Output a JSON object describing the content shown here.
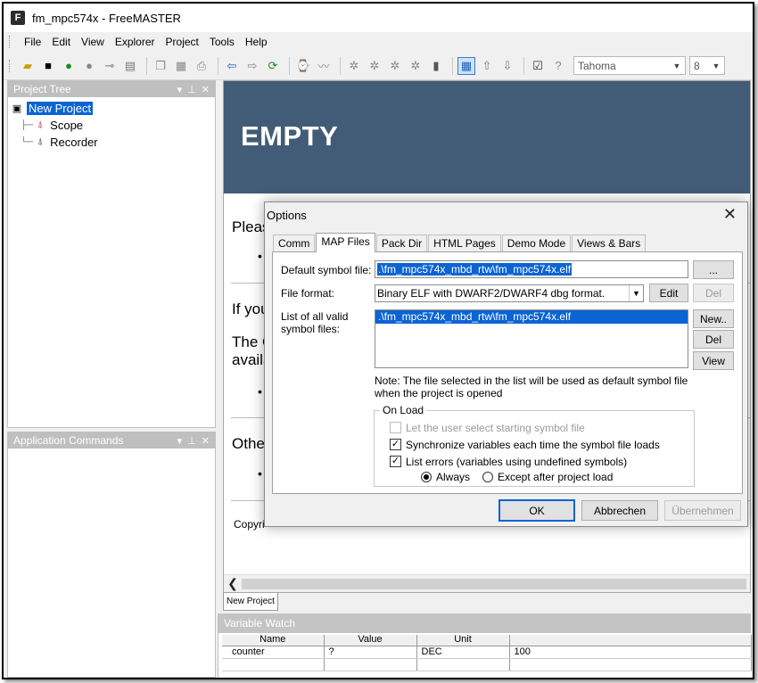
{
  "window": {
    "title": "fm_mpc574x - FreeMASTER",
    "app_icon": "F"
  },
  "menu": [
    "File",
    "Edit",
    "View",
    "Explorer",
    "Project",
    "Tools",
    "Help"
  ],
  "toolbar": {
    "font_name": "Tahoma",
    "font_size": "8",
    "icons": [
      "open-folder-icon",
      "save-icon",
      "go-icon",
      "stop-icon",
      "key-icon",
      "properties-icon",
      "copy-icon",
      "paste-icon",
      "print-icon",
      "back-arrow-icon",
      "forward-arrow-icon",
      "refresh-icon",
      "watch-icon",
      "oscilloscope-icon",
      "bug1-icon",
      "bug2-icon",
      "bug3-icon",
      "bug4-icon",
      "clipboard-icon",
      "grid-icon",
      "up-arrow-icon",
      "down-arrow-icon",
      "options-icon",
      "help-icon"
    ]
  },
  "project_tree": {
    "header": "Project Tree",
    "root": "New Project",
    "children": [
      "Scope",
      "Recorder"
    ]
  },
  "app_commands": {
    "header": "Application Commands"
  },
  "content": {
    "hero_title": "EMPTY",
    "please": "Pleas",
    "if_you": "If you",
    "the": "The C",
    "avail": "availa",
    "other": "Othe",
    "copyright": "Copyri",
    "bullet": "•"
  },
  "doc_tab": "New Project",
  "variable_watch": {
    "header": "Variable Watch",
    "columns": [
      "Name",
      "Value",
      "Unit",
      ""
    ],
    "rows": [
      [
        "counter",
        "?",
        "DEC",
        "100"
      ]
    ]
  },
  "dialog": {
    "title": "Options",
    "close_glyph": "✕",
    "tabs": [
      "Comm",
      "MAP Files",
      "Pack Dir",
      "HTML Pages",
      "Demo Mode",
      "Views & Bars"
    ],
    "active_tab": "MAP Files",
    "default_symbol_label": "Default symbol file:",
    "default_symbol_value": ".\\fm_mpc574x_mbd_rtw\\fm_mpc574x.elf",
    "browse_label": "...",
    "file_format_label": "File format:",
    "file_format_value": "Binary ELF with DWARF2/DWARF4 dbg format.",
    "edit_label": "Edit",
    "del_top_label": "Del",
    "list_label_1": "List of all valid",
    "list_label_2": "symbol files:",
    "list_items": [
      ".\\fm_mpc574x_mbd_rtw\\fm_mpc574x.elf"
    ],
    "new_label": "New..",
    "del_label": "Del",
    "view_label": "View",
    "note_1": "Note: The file selected in the list will be used as default symbol file",
    "note_2": "when the project is opened",
    "on_load_title": "On Load",
    "opt_let_user": "Let the user select starting symbol file",
    "opt_let_user_checked": false,
    "opt_sync": "Synchronize variables each time the symbol file loads",
    "opt_sync_checked": true,
    "opt_list_errors": "List errors (variables using undefined symbols)",
    "opt_list_errors_checked": true,
    "radio_always": "Always",
    "radio_except": "Except after project load",
    "radio_selected": "Always",
    "ok_label": "OK",
    "cancel_label": "Abbrechen",
    "apply_label": "Übernehmen"
  }
}
